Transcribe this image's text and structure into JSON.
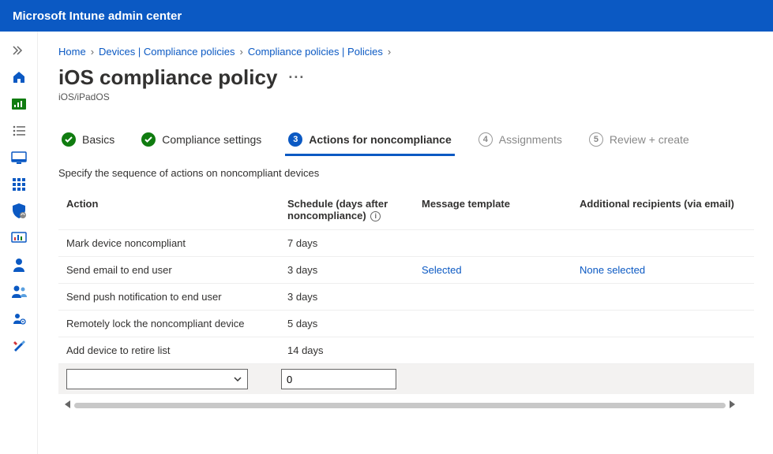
{
  "header": {
    "title": "Microsoft Intune admin center"
  },
  "breadcrumb": {
    "items": [
      "Home",
      "Devices | Compliance policies",
      "Compliance policies | Policies"
    ]
  },
  "page": {
    "title": "iOS compliance policy",
    "subtitle": "iOS/iPadOS"
  },
  "steps": [
    {
      "label": "Basics",
      "state": "done"
    },
    {
      "label": "Compliance settings",
      "state": "done"
    },
    {
      "num": "3",
      "label": "Actions for noncompliance",
      "state": "active"
    },
    {
      "num": "4",
      "label": "Assignments",
      "state": "pending"
    },
    {
      "num": "5",
      "label": "Review + create",
      "state": "pending"
    }
  ],
  "instruction": "Specify the sequence of actions on noncompliant devices",
  "table": {
    "headers": {
      "action": "Action",
      "schedule": "Schedule (days after noncompliance)",
      "message": "Message template",
      "recipients": "Additional recipients (via email)"
    },
    "rows": [
      {
        "action": "Mark device noncompliant",
        "schedule": "7 days",
        "message": "",
        "recipients": ""
      },
      {
        "action": "Send email to end user",
        "schedule": "3 days",
        "message": "Selected",
        "recipients": "None selected"
      },
      {
        "action": "Send push notification to end user",
        "schedule": "3 days",
        "message": "",
        "recipients": ""
      },
      {
        "action": "Remotely lock the noncompliant device",
        "schedule": "5 days",
        "message": "",
        "recipients": ""
      },
      {
        "action": "Add device to retire list",
        "schedule": "14 days",
        "message": "",
        "recipients": ""
      }
    ],
    "input_row": {
      "schedule_value": "0"
    }
  },
  "sidebar_icons": [
    "expand-icon",
    "home-icon",
    "dashboard-icon",
    "list-icon",
    "monitor-icon",
    "apps-icon",
    "security-icon",
    "report-icon",
    "user-icon",
    "users-icon",
    "gear-user-icon",
    "tools-icon"
  ]
}
